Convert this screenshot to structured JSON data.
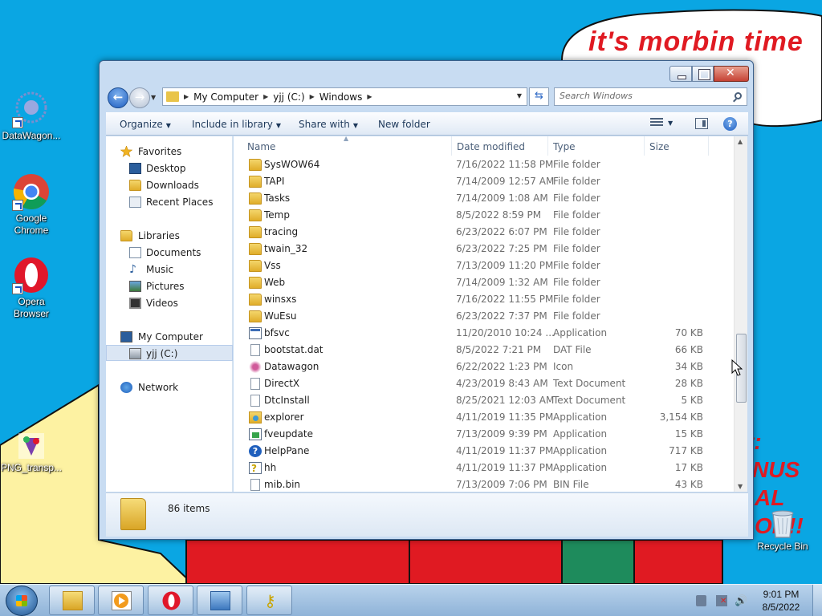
{
  "wallpaper": {
    "caption": "it's morbin time",
    "side_lines": [
      "t:",
      "NUS",
      "AL",
      "ON!!"
    ],
    "colors": {
      "sky": "#0aa6e3",
      "red": "#e01a22",
      "yellow": "#fdf2a2",
      "green": "#1e8b5c"
    }
  },
  "desktop": {
    "icons": [
      {
        "label": "DataWagon...",
        "icon": "datawagon-icon"
      },
      {
        "label": "Google Chrome",
        "icon": "chrome-icon"
      },
      {
        "label": "Opera Browser",
        "icon": "opera-icon"
      },
      {
        "label": "PNG_transp...",
        "icon": "png-file-icon"
      },
      {
        "label": "Recycle Bin",
        "icon": "recycle-bin-icon"
      }
    ]
  },
  "window": {
    "address": {
      "crumbs": [
        "My Computer",
        "yjj (C:)",
        "Windows"
      ]
    },
    "search": {
      "placeholder": "Search Windows"
    },
    "toolbar": {
      "organize": "Organize",
      "include_in_library": "Include in library",
      "share_with": "Share with",
      "new_folder": "New folder"
    },
    "nav": {
      "favorites": "Favorites",
      "desktop": "Desktop",
      "downloads": "Downloads",
      "recent_places": "Recent Places",
      "libraries": "Libraries",
      "documents": "Documents",
      "music": "Music",
      "pictures": "Pictures",
      "videos": "Videos",
      "my_computer": "My Computer",
      "drive": "yjj (C:)",
      "network": "Network"
    },
    "columns": {
      "name": "Name",
      "date": "Date modified",
      "type": "Type",
      "size": "Size"
    },
    "files": [
      {
        "name": "SysWOW64",
        "date": "7/16/2022 11:58 PM",
        "type": "File folder",
        "size": "",
        "icon": "folder"
      },
      {
        "name": "TAPI",
        "date": "7/14/2009 12:57 AM",
        "type": "File folder",
        "size": "",
        "icon": "folder"
      },
      {
        "name": "Tasks",
        "date": "7/14/2009 1:08 AM",
        "type": "File folder",
        "size": "",
        "icon": "folder"
      },
      {
        "name": "Temp",
        "date": "8/5/2022 8:59 PM",
        "type": "File folder",
        "size": "",
        "icon": "folder"
      },
      {
        "name": "tracing",
        "date": "6/23/2022 6:07 PM",
        "type": "File folder",
        "size": "",
        "icon": "folder"
      },
      {
        "name": "twain_32",
        "date": "6/23/2022 7:25 PM",
        "type": "File folder",
        "size": "",
        "icon": "folder"
      },
      {
        "name": "Vss",
        "date": "7/13/2009 11:20 PM",
        "type": "File folder",
        "size": "",
        "icon": "folder"
      },
      {
        "name": "Web",
        "date": "7/14/2009 1:32 AM",
        "type": "File folder",
        "size": "",
        "icon": "folder"
      },
      {
        "name": "winsxs",
        "date": "7/16/2022 11:55 PM",
        "type": "File folder",
        "size": "",
        "icon": "folder"
      },
      {
        "name": "WuEsu",
        "date": "6/23/2022 7:37 PM",
        "type": "File folder",
        "size": "",
        "icon": "folder"
      },
      {
        "name": "bfsvc",
        "date": "11/20/2010 10:24 ...",
        "type": "Application",
        "size": "70 KB",
        "icon": "app"
      },
      {
        "name": "bootstat.dat",
        "date": "8/5/2022 7:21 PM",
        "type": "DAT File",
        "size": "66 KB",
        "icon": "file"
      },
      {
        "name": "Datawagon",
        "date": "6/22/2022 1:23 PM",
        "type": "Icon",
        "size": "34 KB",
        "icon": "star"
      },
      {
        "name": "DirectX",
        "date": "4/23/2019 8:43 AM",
        "type": "Text Document",
        "size": "28 KB",
        "icon": "file"
      },
      {
        "name": "DtcInstall",
        "date": "8/25/2021 12:03 AM",
        "type": "Text Document",
        "size": "5 KB",
        "icon": "file"
      },
      {
        "name": "explorer",
        "date": "4/11/2019 11:35 PM",
        "type": "Application",
        "size": "3,154 KB",
        "icon": "explorer"
      },
      {
        "name": "fveupdate",
        "date": "7/13/2009 9:39 PM",
        "type": "Application",
        "size": "15 KB",
        "icon": "fve"
      },
      {
        "name": "HelpPane",
        "date": "4/11/2019 11:37 PM",
        "type": "Application",
        "size": "717 KB",
        "icon": "help"
      },
      {
        "name": "hh",
        "date": "4/11/2019 11:37 PM",
        "type": "Application",
        "size": "17 KB",
        "icon": "hh"
      },
      {
        "name": "mib.bin",
        "date": "7/13/2009 7:06 PM",
        "type": "BIN File",
        "size": "43 KB",
        "icon": "file"
      }
    ],
    "status": {
      "count": "86 items"
    }
  },
  "taskbar": {
    "apps": [
      "explorer-icon",
      "media-player-icon",
      "opera-icon",
      "control-panel-icon",
      "keys-icon"
    ],
    "clock": {
      "time": "9:01 PM",
      "date": "8/5/2022"
    }
  }
}
